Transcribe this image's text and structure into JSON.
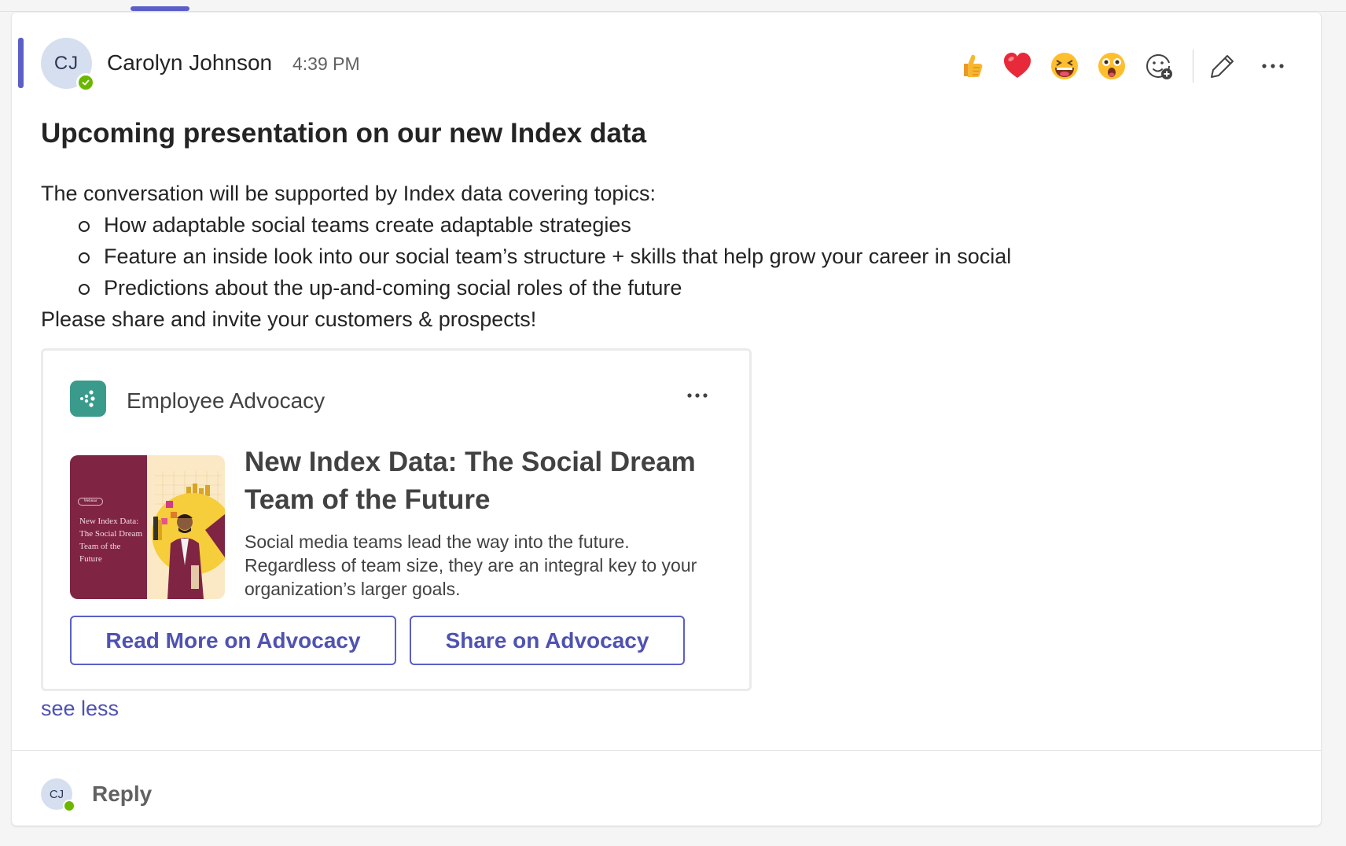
{
  "message": {
    "author_initials": "CJ",
    "author_name": "Carolyn Johnson",
    "time": "4:39 PM",
    "subject": "Upcoming presentation on our new Index data",
    "intro": "The conversation will be supported by Index data covering topics:",
    "bullets": [
      "How adaptable social teams create adaptable strategies",
      "Feature an inside look into our social team’s structure + skills that help grow your career in social",
      "Predictions about the up-and-coming social roles of the future"
    ],
    "closing": "Please share and invite your customers & prospects!",
    "see_less": "see less"
  },
  "reactions": [
    {
      "name": "like",
      "icon": "thumbs-up-icon"
    },
    {
      "name": "heart",
      "icon": "heart-icon"
    },
    {
      "name": "laugh",
      "icon": "laughing-face-icon"
    },
    {
      "name": "surprised",
      "icon": "surprised-face-icon"
    },
    {
      "name": "more-reactions",
      "icon": "add-emoji-icon"
    }
  ],
  "toolbar": {
    "edit_icon": "pencil-icon",
    "more_icon": "more-options-icon"
  },
  "adaptive_card": {
    "app_name": "Employee Advocacy",
    "thumbnail": {
      "badge": "Webinar",
      "title": "New Index Data: The Social Dream Team of the Future"
    },
    "title": "New Index Data: The Social Dream Team of the Future",
    "description": "Social media teams lead the way into the future. Regardless of team size, they are an integral key to your organization’s larger goals.",
    "buttons": {
      "read_more": "Read More on Advocacy",
      "share": "Share on Advocacy"
    }
  },
  "reply": {
    "initials": "CJ",
    "label": "Reply"
  },
  "colors": {
    "accent": "#5b5fc7",
    "link": "#4f52b2",
    "presence": "#6bb700",
    "app_icon": "#3a9a8c",
    "thumb_maroon": "#7f2443"
  }
}
